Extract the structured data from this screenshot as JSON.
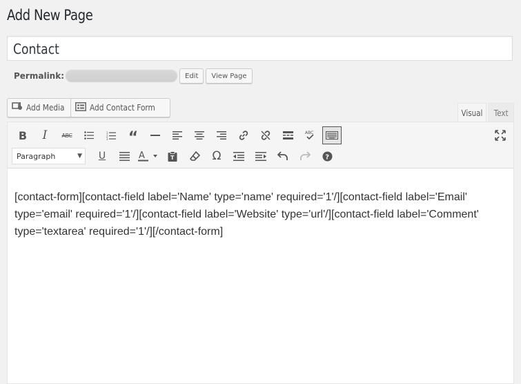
{
  "page": {
    "title": "Add New Page"
  },
  "post": {
    "title_value": "Contact",
    "permalink_label": "Permalink:",
    "edit_label": "Edit",
    "view_label": "View Page"
  },
  "media_buttons": {
    "add_media": "Add Media",
    "add_contact_form": "Add Contact Form"
  },
  "editor_tabs": {
    "visual": "Visual",
    "text": "Text"
  },
  "toolbar": {
    "format_select": "Paragraph",
    "icons_row1": [
      "bold-icon",
      "italic-icon",
      "strikethrough-icon",
      "bulleted-list-icon",
      "numbered-list-icon",
      "blockquote-icon",
      "horizontal-rule-icon",
      "align-left-icon",
      "align-center-icon",
      "align-right-icon",
      "link-icon",
      "unlink-icon",
      "read-more-icon",
      "spellcheck-icon",
      "toolbar-toggle-icon",
      "fullscreen-icon"
    ],
    "icons_row2": [
      "underline-icon",
      "justify-icon",
      "text-color-icon",
      "paste-text-icon",
      "clear-formatting-icon",
      "special-character-icon",
      "outdent-icon",
      "indent-icon",
      "undo-icon",
      "redo-icon",
      "help-icon"
    ]
  },
  "content": {
    "text": "[contact-form][contact-field label='Name' type='name' required='1'/][contact-field label='Email' type='email' required='1'/][contact-field label='Website' type='url'/][contact-field label='Comment' type='textarea' required='1'/][/contact-form]"
  }
}
